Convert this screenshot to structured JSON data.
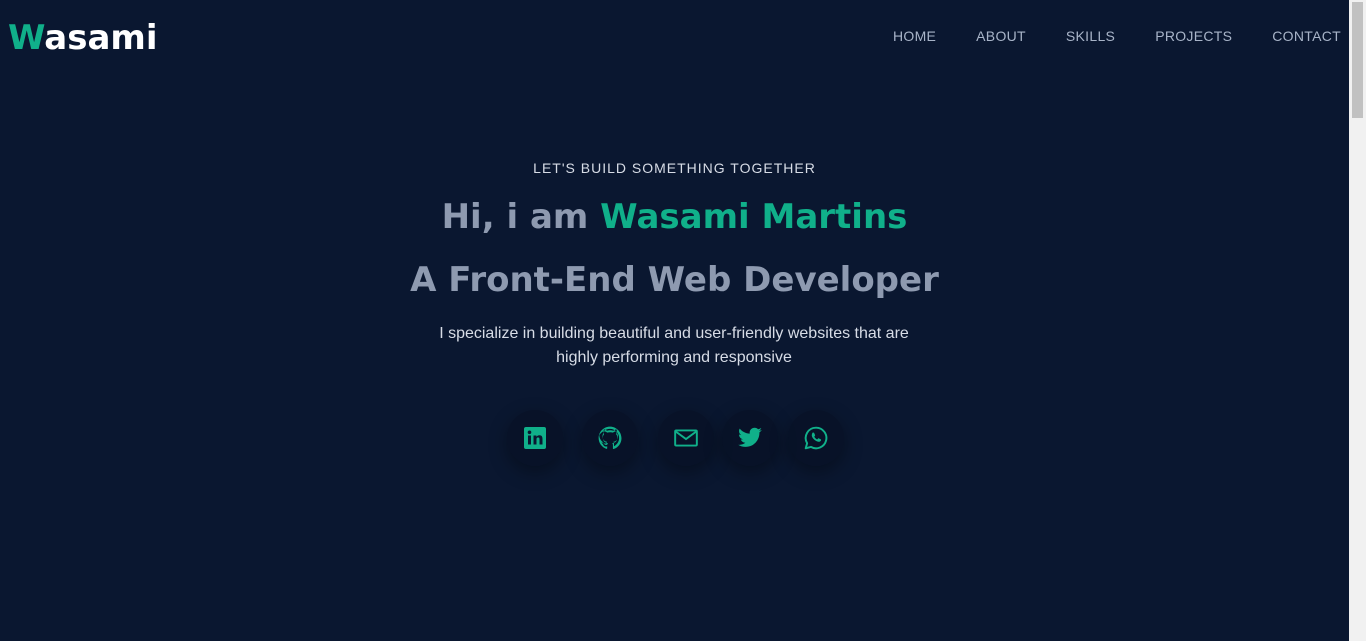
{
  "brand": {
    "accent_letter": "W",
    "rest": "asami",
    "accent_color": "#10b08a"
  },
  "nav": {
    "items": [
      {
        "label": "HOME"
      },
      {
        "label": "ABOUT"
      },
      {
        "label": "SKILLS"
      },
      {
        "label": "PROJECTS"
      },
      {
        "label": "CONTACT"
      }
    ]
  },
  "hero": {
    "eyebrow": "LET'S BUILD SOMETHING TOGETHER",
    "greeting": "Hi, i am ",
    "name": "Wasami Martins",
    "role": "A Front-End Web Developer",
    "description": "I specialize in building beautiful and user-friendly websites that are highly performing and responsive"
  },
  "socials": [
    {
      "icon": "linkedin-icon"
    },
    {
      "icon": "github-icon"
    },
    {
      "icon": "mail-icon"
    },
    {
      "icon": "twitter-icon"
    },
    {
      "icon": "whatsapp-icon"
    }
  ],
  "colors": {
    "background": "#0a1730",
    "accent": "#10b08a",
    "muted_heading": "#8e9ab0",
    "body_text": "#d7dce6"
  }
}
